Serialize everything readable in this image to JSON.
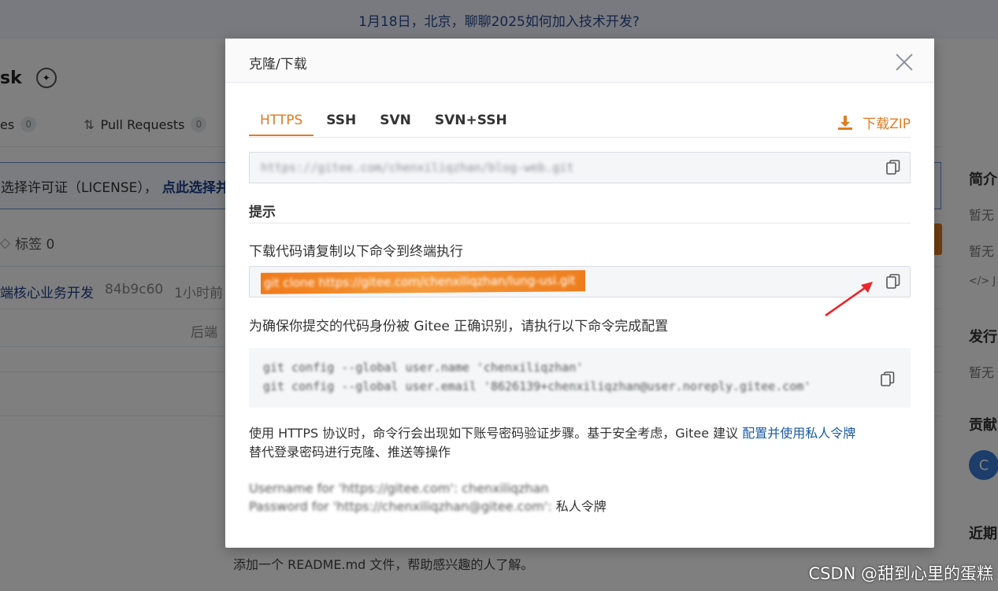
{
  "background": {
    "banner_text": "1月18日，北京，聊聊2025如何加入技术开发?",
    "repo_title": "sk",
    "tabs": [
      {
        "label": "es",
        "count": "0"
      },
      {
        "label": "Pull Requests",
        "count": "0"
      }
    ],
    "license_text": "选择许可证（LICENSE），",
    "license_link": "点此选择并创",
    "tags_label": "标签 0",
    "commit": {
      "message": "端核心业务开发",
      "hash": "84b9c60",
      "time": "1小时前"
    },
    "backend_text": "后端",
    "readme_hint": "添加一个 README.md 文件，帮助感兴趣的人了解。",
    "right_col": {
      "h1": "简介",
      "t1": "暂无",
      "t2": "暂无",
      "t3": "</> J",
      "h2": "发行",
      "t4": "暂无",
      "h3": "贡献",
      "avatar": "C",
      "h4": "近期"
    },
    "watermark": "CSDN @甜到心里的蛋糕"
  },
  "modal": {
    "title": "克隆/下载",
    "protocol_tabs": [
      "HTTPS",
      "SSH",
      "SVN",
      "SVN+SSH"
    ],
    "active_tab": "HTTPS",
    "download_zip_label": "下载ZIP",
    "clone_url": "https://gitee.com/chenxiliqzhan/blog-web.git",
    "hint_title": "提示",
    "instruction_1": "下载代码请复制以下命令到终端执行",
    "clone_command": "git clone https://gitee.com/chenxiliqzhan/lung-usi.git",
    "instruction_2": "为确保你提交的代码身份被 Gitee 正确识别，请执行以下命令完成配置",
    "config_line_1": "git config --global user.name 'chenxiliqzhan'",
    "config_line_2": "git config --global user.email '8626139+chenxiliqzhan@user.noreply.gitee.com'",
    "https_note": "使用 HTTPS 协议时，命令行会出现如下账号密码验证步骤。基于安全考虑，Gitee 建议",
    "https_note_link": "配置并使用私人令牌",
    "https_note_tail": "替代登录密码进行克隆、推送等操作",
    "username_line": "Username for 'https://gitee.com': chenxiliqzhan",
    "password_line_blurred": "Password for 'https://chenxiliqzhan@gitee.com':",
    "password_line_tail": "私人令牌"
  },
  "colors": {
    "accent": "#e07b22",
    "link": "#1a5ba6",
    "highlight": "#f07a18",
    "arrow": "#e8262b"
  }
}
